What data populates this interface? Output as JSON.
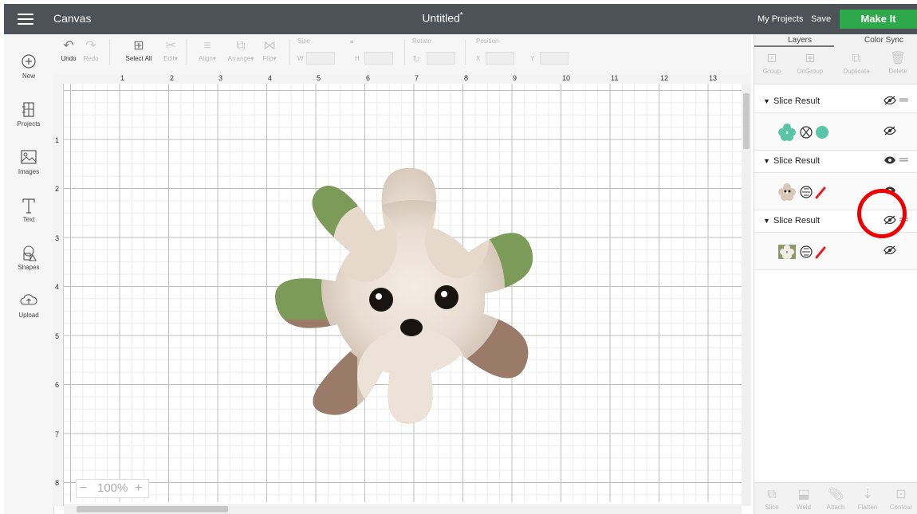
{
  "header": {
    "app_title": "Canvas",
    "doc_title": "Untitled",
    "unsaved_mark": "*",
    "my_projects": "My Projects",
    "save": "Save",
    "make_it": "Make It",
    "make_it_color": "#2ea84b"
  },
  "sidebar": {
    "items": [
      {
        "label": "New",
        "icon": "plus-circle-icon"
      },
      {
        "label": "Projects",
        "icon": "projects-icon"
      },
      {
        "label": "Images",
        "icon": "image-icon"
      },
      {
        "label": "Text",
        "icon": "text-icon"
      },
      {
        "label": "Shapes",
        "icon": "shapes-icon"
      },
      {
        "label": "Upload",
        "icon": "upload-cloud-icon"
      }
    ]
  },
  "toolbar": {
    "undo": "Undo",
    "redo": "Redo",
    "select_all": "Select All",
    "edit": "Edit",
    "align": "Align",
    "arrange": "Arrange",
    "flip": "Flip",
    "size": "Size",
    "w": "W",
    "h": "H",
    "rotate": "Rotate",
    "position": "Position",
    "x": "X",
    "y": "Y"
  },
  "ruler": {
    "top": [
      "1",
      "2",
      "3",
      "4",
      "5",
      "6",
      "7",
      "8",
      "9",
      "10",
      "11",
      "12",
      "13"
    ],
    "left": [
      "1",
      "2",
      "3",
      "4",
      "5",
      "6",
      "7",
      "8"
    ]
  },
  "zoom": {
    "value": "100%",
    "minus": "−",
    "plus": "+"
  },
  "panel": {
    "tabs": [
      "Layers",
      "Color Sync"
    ],
    "tools": [
      "Group",
      "UnGroup",
      "Duplicate",
      "Delete"
    ],
    "layers": [
      {
        "name": "Slice Result",
        "visible": false
      },
      {
        "name": "Slice Result",
        "visible": true
      },
      {
        "name": "Slice Result",
        "visible": false
      }
    ],
    "bottom_tools": [
      "Slice",
      "Weld",
      "Attach",
      "Flatten",
      "Contour"
    ]
  },
  "annotation_color": "#ee0000"
}
